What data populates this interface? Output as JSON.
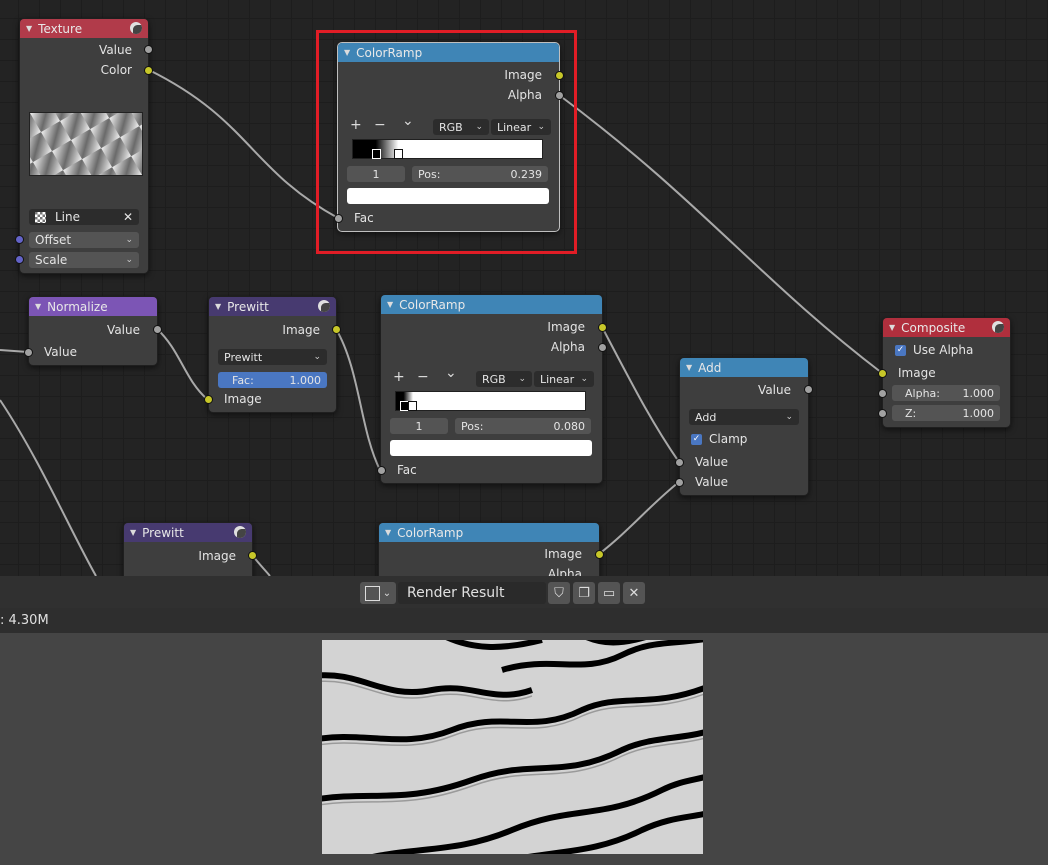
{
  "nodes": {
    "texture": {
      "title": "Texture",
      "out_value": "Value",
      "out_color": "Color",
      "texture_name": "Line",
      "offset_label": "Offset",
      "scale_label": "Scale"
    },
    "colorramp_top": {
      "title": "ColorRamp",
      "out_image": "Image",
      "out_alpha": "Alpha",
      "mode": "RGB",
      "interp": "Linear",
      "stop_index": "1",
      "pos_label": "Pos:",
      "pos_value": "0.239",
      "in_fac": "Fac",
      "plus": "+",
      "minus": "−",
      "more": "⌄"
    },
    "normalize": {
      "title": "Normalize",
      "out_value": "Value",
      "in_value": "Value"
    },
    "prewitt_1": {
      "title": "Prewitt",
      "out_image": "Image",
      "filter_type": "Prewitt",
      "fac_label": "Fac:",
      "fac_value": "1.000",
      "in_image": "Image"
    },
    "colorramp_mid": {
      "title": "ColorRamp",
      "out_image": "Image",
      "out_alpha": "Alpha",
      "mode": "RGB",
      "interp": "Linear",
      "stop_index": "1",
      "pos_label": "Pos:",
      "pos_value": "0.080",
      "in_fac": "Fac",
      "plus": "+",
      "minus": "−",
      "more": "⌄"
    },
    "add": {
      "title": "Add",
      "out_value": "Value",
      "operation": "Add",
      "clamp_label": "Clamp",
      "in_value_1": "Value",
      "in_value_2": "Value"
    },
    "composite": {
      "title": "Composite",
      "use_alpha_label": "Use Alpha",
      "in_image": "Image",
      "alpha_label": "Alpha:",
      "alpha_value": "1.000",
      "z_label": "Z:",
      "z_value": "1.000"
    },
    "prewitt_2": {
      "title": "Prewitt",
      "out_image": "Image"
    },
    "colorramp_bottom": {
      "title": "ColorRamp",
      "out_image": "Image",
      "out_alpha": "Alpha"
    }
  },
  "image_editor": {
    "image_name": "Render Result",
    "metadata": ": 4.30M"
  },
  "colors": {
    "highlight": "#e11d26",
    "converter_header": "#3f85b6",
    "texture_header": "#b13b4a",
    "output_header": "#b02f3d",
    "filter_header": "#473a70",
    "vector_header": "#7c55b5"
  }
}
